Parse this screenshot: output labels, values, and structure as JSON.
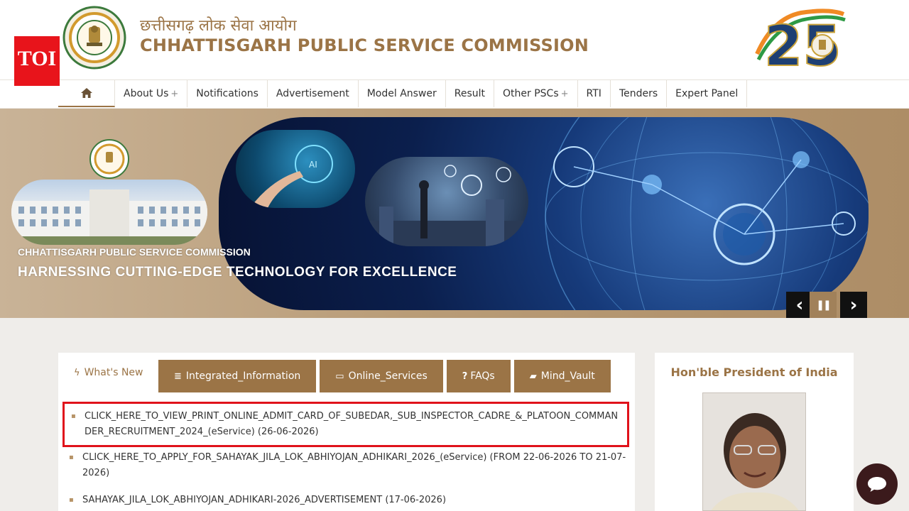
{
  "header": {
    "toi_logo": "TOI",
    "hindi_title": "छत्तीसगढ़ लोक सेवा आयोग",
    "english_title": "CHHATTISGARH PUBLIC SERVICE COMMISSION",
    "anniversary_logo": "25"
  },
  "nav": {
    "home_icon": "home-icon",
    "items": [
      {
        "label": "About Us",
        "has_submenu": true
      },
      {
        "label": "Notifications",
        "has_submenu": false
      },
      {
        "label": "Advertisement",
        "has_submenu": false
      },
      {
        "label": "Model Answer",
        "has_submenu": false
      },
      {
        "label": "Result",
        "has_submenu": false
      },
      {
        "label": "Other PSCs",
        "has_submenu": true
      },
      {
        "label": "RTI",
        "has_submenu": false
      },
      {
        "label": "Tenders",
        "has_submenu": false
      },
      {
        "label": "Expert Panel",
        "has_submenu": false
      }
    ],
    "submenu_marker": "+"
  },
  "banner": {
    "org_name": "CHHATTISGARH PUBLIC SERVICE COMMISSION",
    "tagline": "HARNESSING CUTTING-EDGE TECHNOLOGY FOR EXCELLENCE",
    "ai_label": "AI",
    "controls": {
      "prev": "‹",
      "pause": "❚❚",
      "next": "›"
    }
  },
  "tabs": [
    {
      "label": "What's New",
      "icon": "bolt-icon",
      "glyph": "ϟ",
      "active": true
    },
    {
      "label": "Integrated_Information",
      "icon": "database-icon",
      "glyph": "≣",
      "active": false
    },
    {
      "label": "Online_Services",
      "icon": "laptop-icon",
      "glyph": "▭",
      "active": false
    },
    {
      "label": "FAQs",
      "icon": "question-icon",
      "glyph": "?",
      "active": false
    },
    {
      "label": "Mind_Vault",
      "icon": "book-icon",
      "glyph": "▰",
      "active": false
    }
  ],
  "news": [
    {
      "text": "CLICK_HERE_TO_VIEW_PRINT_ONLINE_ADMIT_CARD_OF_SUBEDAR,_SUB_INSPECTOR_CADRE_&_PLATOON_COMMANDER_RECRUITMENT_2024_(eService) (26-06-2026)",
      "highlighted": true
    },
    {
      "text": "CLICK_HERE_TO_APPLY_FOR_SAHAYAK_JILA_LOK_ABHIYOJAN_ADHIKARI_2026_(eService) (FROM 22-06-2026 TO 21-07-2026)",
      "highlighted": false
    },
    {
      "text": "SAHAYAK_JILA_LOK_ABHIYOJAN_ADHIKARI-2026_ADVERTISEMENT (17-06-2026)",
      "highlighted": false
    }
  ],
  "news_bullet": "▪",
  "president": {
    "title": "Hon'ble President of India"
  },
  "chat": {
    "icon": "chat-icon"
  },
  "colors": {
    "brand_brown": "#9b7446",
    "highlight_red": "#e0121b",
    "toi_red": "#e8141b"
  }
}
